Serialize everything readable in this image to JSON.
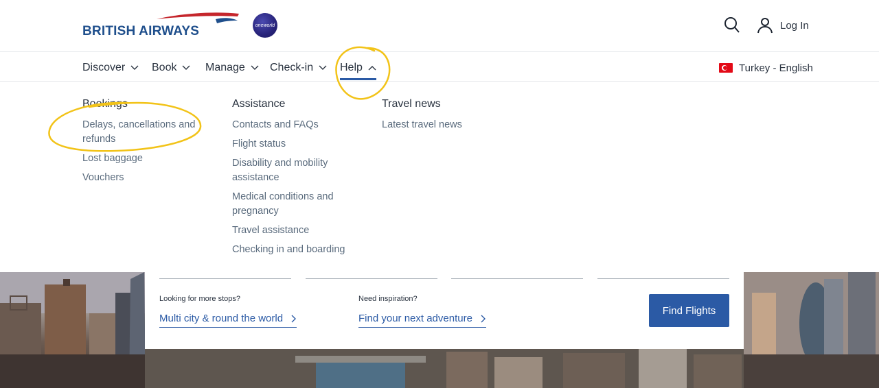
{
  "brand": {
    "name": "BRITISH AIRWAYS",
    "alliance": "oneworld"
  },
  "header": {
    "login_label": "Log In"
  },
  "nav": {
    "items": [
      {
        "label": "Discover"
      },
      {
        "label": "Book"
      },
      {
        "label": "Manage"
      },
      {
        "label": "Check-in"
      },
      {
        "label": "Help",
        "expanded": true
      }
    ],
    "region": "Turkey - English"
  },
  "menu": {
    "bookings": {
      "heading": "Bookings",
      "links": [
        "Delays, cancellations and refunds",
        "Lost baggage",
        "Vouchers"
      ]
    },
    "assistance": {
      "heading": "Assistance",
      "links": [
        "Contacts and FAQs",
        "Flight status",
        "Disability and mobility assistance",
        "Medical conditions and pregnancy",
        "Travel assistance",
        "Checking in and boarding"
      ]
    },
    "travel_news": {
      "heading": "Travel news",
      "links": [
        "Latest travel news"
      ]
    }
  },
  "booking": {
    "more_stops_label": "Looking for more stops?",
    "multi_city_link": "Multi city & round the world",
    "inspiration_label": "Need inspiration?",
    "adventure_link": "Find your next adventure",
    "find_flights": "Find Flights"
  },
  "colors": {
    "brand_blue": "#2b5aa5",
    "link_grey": "#5a6b7d",
    "annotation_yellow": "#f2c318"
  }
}
